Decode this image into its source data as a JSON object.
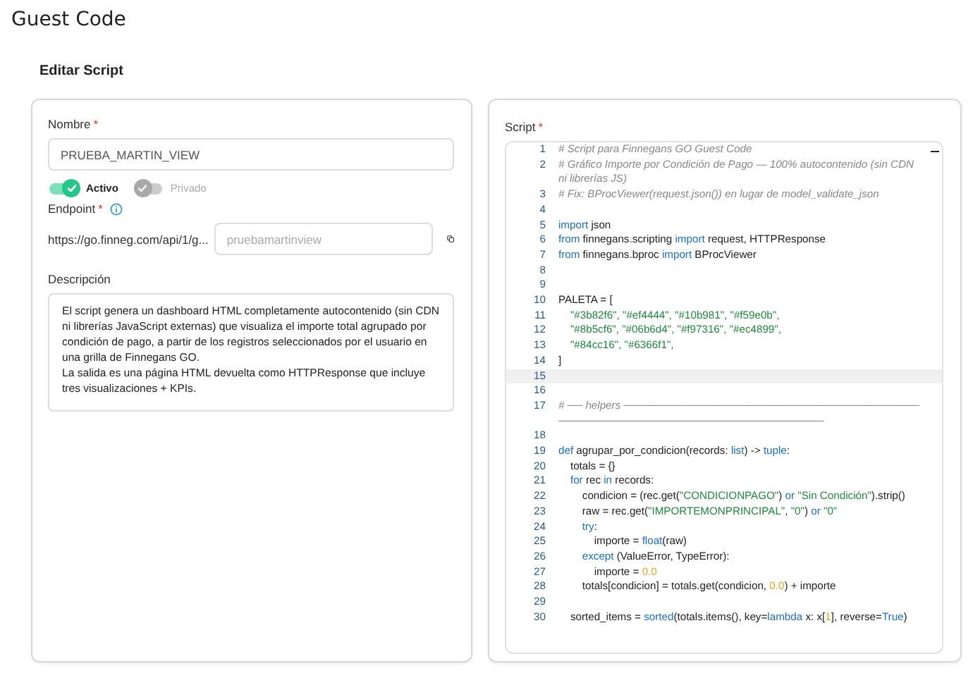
{
  "page_title": "Guest Code",
  "section_title": "Editar Script",
  "form": {
    "name": {
      "label": "Nombre",
      "required_mark": "*",
      "value": "PRUEBA_MARTIN_VIEW"
    },
    "toggles": [
      {
        "label": "Activo",
        "on": true
      },
      {
        "label": "Privado",
        "on": false
      }
    ],
    "endpoint": {
      "label": "Endpoint",
      "required_mark": "*",
      "url": "https://go.finneg.com/api/1/g...",
      "placeholder": "pruebamartinview"
    },
    "description": {
      "label": "Descripción",
      "value": "El script genera un dashboard HTML completamente autocontenido (sin CDN ni librerías JavaScript externas) que visualiza el importe total agrupado por condición de pago, a partir de los registros seleccionados por el usuario en una grilla de Finnegans GO.\nLa salida es una página HTML devuelta como HTTPResponse que incluye tres visualizaciones + KPIs."
    }
  },
  "script": {
    "label": "Script",
    "required_mark": "*",
    "lines": [
      {
        "number": "1",
        "current": false,
        "tokens": [
          {
            "kind": "comment",
            "text": "# Script para Finnegans GO Guest Code"
          }
        ]
      },
      {
        "number": "2",
        "current": false,
        "tokens": [
          {
            "kind": "comment",
            "text": "# Gráfico Importe por Condición de Pago — 100% autocontenido (sin CDN ni librerías JS)"
          }
        ]
      },
      {
        "number": "3",
        "current": false,
        "tokens": [
          {
            "kind": "comment",
            "text": "# Fix: BProcViewer(request.json()) en lugar de model_validate_json"
          }
        ]
      },
      {
        "number": "4",
        "current": false
      },
      {
        "number": "5",
        "current": false,
        "tokens": [
          {
            "kind": "keyword",
            "text": "import"
          },
          {
            "kind": "plain",
            "text": " json"
          }
        ]
      },
      {
        "number": "6",
        "current": false,
        "tokens": [
          {
            "kind": "keyword",
            "text": "from"
          },
          {
            "kind": "plain",
            "text": " finnegans.scripting "
          },
          {
            "kind": "keyword",
            "text": "import"
          },
          {
            "kind": "plain",
            "text": " request, HTTPResponse"
          }
        ]
      },
      {
        "number": "7",
        "current": false,
        "tokens": [
          {
            "kind": "keyword",
            "text": "from"
          },
          {
            "kind": "plain",
            "text": " finnegans.bproc "
          },
          {
            "kind": "keyword",
            "text": "import"
          },
          {
            "kind": "plain",
            "text": " BProcViewer"
          }
        ]
      },
      {
        "number": "8",
        "current": false
      },
      {
        "number": "9",
        "current": false
      },
      {
        "number": "10",
        "current": false,
        "tokens": [
          {
            "kind": "plain",
            "text": "PALETA = ["
          }
        ]
      },
      {
        "number": "11",
        "current": false,
        "tokens": [
          {
            "kind": "string",
            "text": "    \"#3b82f6\", \"#ef4444\", \"#10b981\", \"#f59e0b\","
          }
        ]
      },
      {
        "number": "12",
        "current": false,
        "tokens": [
          {
            "kind": "string",
            "text": "    \"#8b5cf6\", \"#06b6d4\", \"#f97316\", \"#ec4899\","
          }
        ]
      },
      {
        "number": "13",
        "current": false,
        "tokens": [
          {
            "kind": "string",
            "text": "    \"#84cc16\", \"#6366f1\","
          }
        ]
      },
      {
        "number": "14",
        "current": false,
        "tokens": [
          {
            "kind": "plain",
            "text": "]"
          }
        ]
      },
      {
        "number": "15",
        "current": true
      },
      {
        "number": "16",
        "current": false
      },
      {
        "number": "17",
        "current": false,
        "tokens": [
          {
            "kind": "comment",
            "text": "# ── helpers ──────────────────────────────────────────────────────────────────────────"
          }
        ]
      },
      {
        "number": "18",
        "current": false
      },
      {
        "number": "19",
        "current": false,
        "tokens": [
          {
            "kind": "keyword",
            "text": "def"
          },
          {
            "kind": "plain",
            "text": " agrupar_por_condicion(records: "
          },
          {
            "kind": "keyword",
            "text": "list"
          },
          {
            "kind": "plain",
            "text": ") -> "
          },
          {
            "kind": "keyword",
            "text": "tuple"
          },
          {
            "kind": "plain",
            "text": ":"
          }
        ]
      },
      {
        "number": "20",
        "current": false,
        "tokens": [
          {
            "kind": "plain",
            "text": "    totals = {}"
          }
        ]
      },
      {
        "number": "21",
        "current": false,
        "tokens": [
          {
            "kind": "keyword",
            "text": "    for"
          },
          {
            "kind": "plain",
            "text": " rec "
          },
          {
            "kind": "keyword",
            "text": "in"
          },
          {
            "kind": "plain",
            "text": " records:"
          }
        ]
      },
      {
        "number": "22",
        "current": false,
        "tokens": [
          {
            "kind": "plain",
            "text": "        condicion = (rec.get("
          },
          {
            "kind": "string",
            "text": "\"CONDICIONPAGO\""
          },
          {
            "kind": "plain",
            "text": ") "
          },
          {
            "kind": "keyword",
            "text": "or"
          },
          {
            "kind": "string",
            "text": " \"Sin Condición\""
          },
          {
            "kind": "plain",
            "text": ").strip()"
          }
        ]
      },
      {
        "number": "23",
        "current": false,
        "tokens": [
          {
            "kind": "plain",
            "text": "        raw = rec.get("
          },
          {
            "kind": "string",
            "text": "\"IMPORTEMONPRINCIPAL\""
          },
          {
            "kind": "plain",
            "text": ", "
          },
          {
            "kind": "string",
            "text": "\"0\""
          },
          {
            "kind": "plain",
            "text": ") "
          },
          {
            "kind": "keyword",
            "text": "or"
          },
          {
            "kind": "string",
            "text": " \"0\""
          }
        ]
      },
      {
        "number": "24",
        "current": false,
        "tokens": [
          {
            "kind": "keyword",
            "text": "        try"
          },
          {
            "kind": "plain",
            "text": ":"
          }
        ]
      },
      {
        "number": "25",
        "current": false,
        "tokens": [
          {
            "kind": "plain",
            "text": "            importe = "
          },
          {
            "kind": "keyword",
            "text": "float"
          },
          {
            "kind": "plain",
            "text": "(raw)"
          }
        ]
      },
      {
        "number": "26",
        "current": false,
        "tokens": [
          {
            "kind": "keyword",
            "text": "        except"
          },
          {
            "kind": "plain",
            "text": " (ValueError, TypeError):"
          }
        ]
      },
      {
        "number": "27",
        "current": false,
        "tokens": [
          {
            "kind": "plain",
            "text": "            importe = "
          },
          {
            "kind": "number",
            "text": "0.0"
          }
        ]
      },
      {
        "number": "28",
        "current": false,
        "tokens": [
          {
            "kind": "plain",
            "text": "        totals[condicion] = totals.get(condicion, "
          },
          {
            "kind": "number",
            "text": "0.0"
          },
          {
            "kind": "plain",
            "text": ") + importe"
          }
        ]
      },
      {
        "number": "29",
        "current": false
      },
      {
        "number": "30",
        "current": false,
        "tokens": [
          {
            "kind": "plain",
            "text": "    sorted_items = "
          },
          {
            "kind": "keyword",
            "text": "sorted"
          },
          {
            "kind": "plain",
            "text": "(totals.items(), key="
          },
          {
            "kind": "keyword",
            "text": "lambda"
          },
          {
            "kind": "plain",
            "text": " x: x["
          },
          {
            "kind": "number",
            "text": "1"
          },
          {
            "kind": "plain",
            "text": "], reverse="
          },
          {
            "kind": "keyword",
            "text": "True"
          },
          {
            "kind": "plain",
            "text": ")"
          }
        ]
      }
    ]
  }
}
